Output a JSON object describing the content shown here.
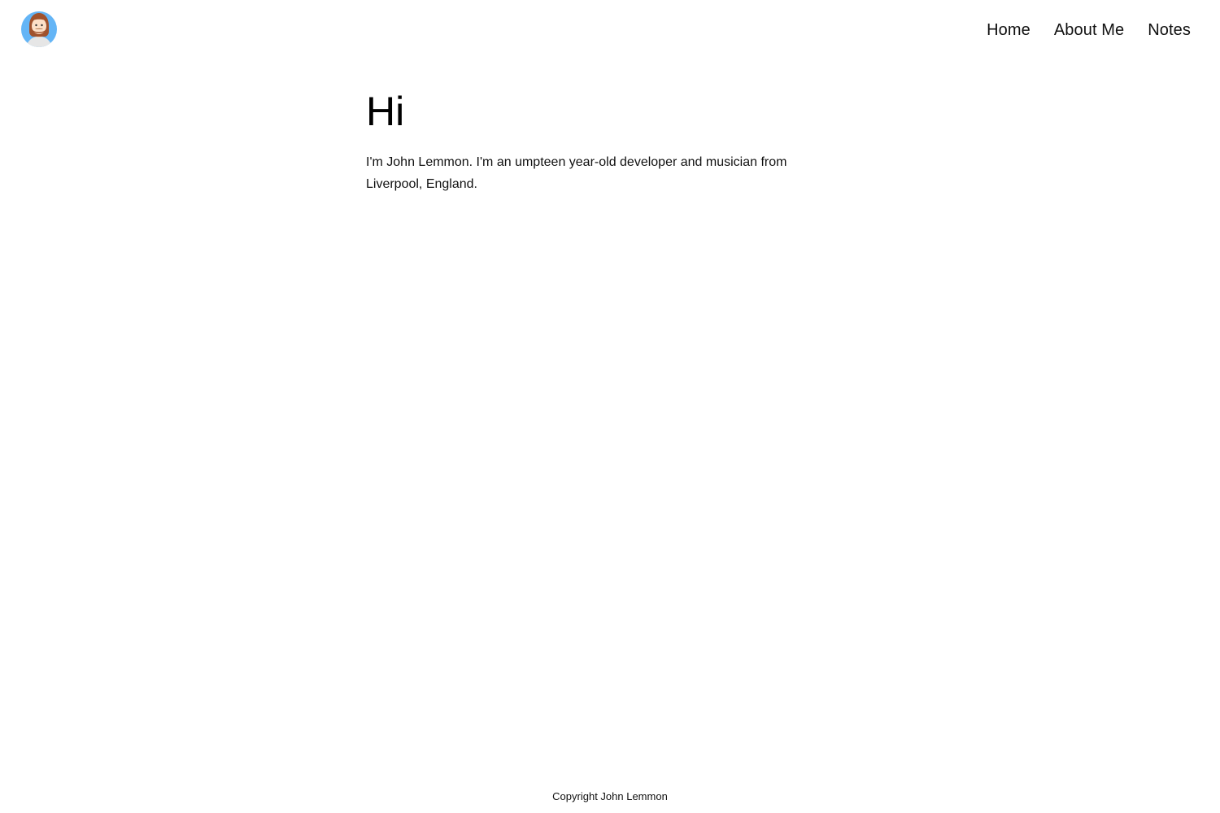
{
  "header": {
    "avatar_icon": "bearded-man-avatar-icon",
    "nav": [
      {
        "label": "Home"
      },
      {
        "label": "About Me"
      },
      {
        "label": "Notes"
      }
    ]
  },
  "main": {
    "title": "Hi",
    "intro": "I'm John Lemmon. I'm an umpteen year-old developer and musician from Liverpool, England."
  },
  "footer": {
    "text": "Copyright John Lemmon"
  },
  "colors": {
    "background": "#ffffff",
    "text": "#111111",
    "avatar_circle": "#64b5f6",
    "avatar_hair": "#a0522d",
    "avatar_skin": "#fde0c8",
    "avatar_shirt": "#e6e6e6"
  }
}
